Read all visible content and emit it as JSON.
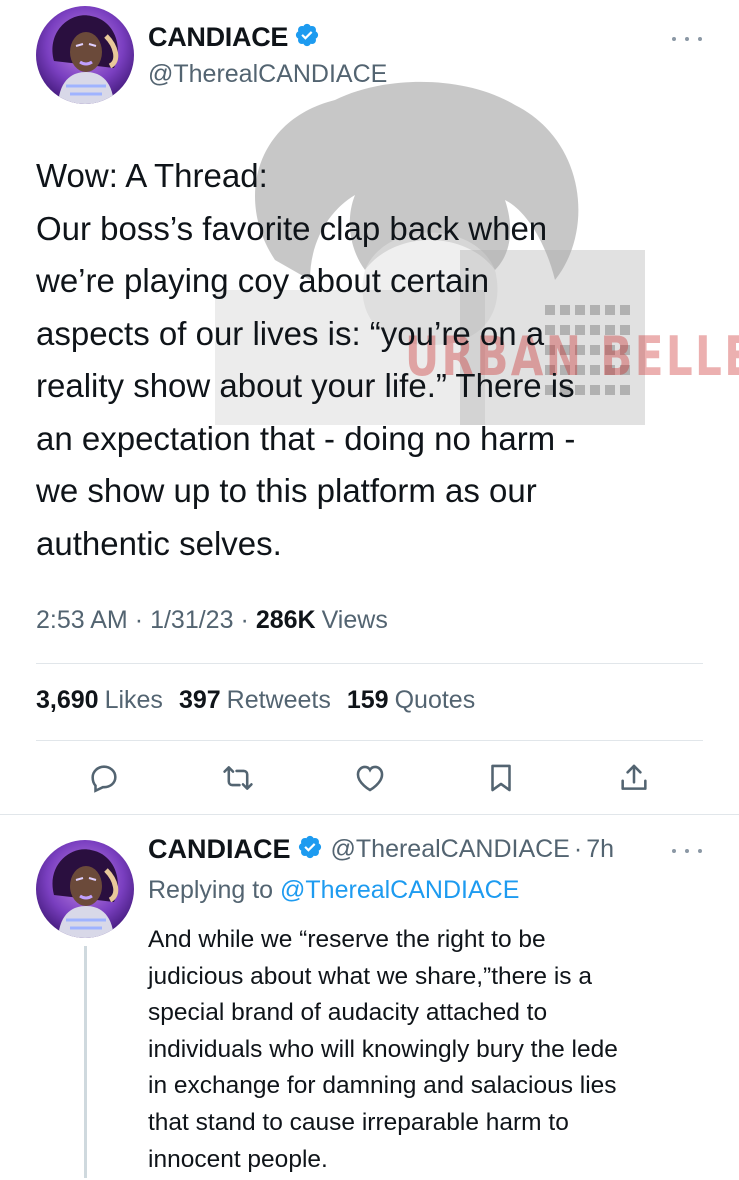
{
  "main_tweet": {
    "display_name": "CANDIACE",
    "handle": "@TherealCANDIACE",
    "text_lines": [
      "Wow: A Thread:",
      "Our boss’s favorite clap back when",
      "we’re playing coy about certain",
      "aspects of our lives is: “you’re on a",
      "reality show about your life.” There is",
      "an expectation that - doing no harm -",
      "we show up to this platform as our",
      "authentic selves."
    ],
    "time": "2:53 AM",
    "date": "1/31/23",
    "separator": "·",
    "views_count": "286K",
    "views_label": "Views",
    "likes_count": "3,690",
    "likes_label": "Likes",
    "retweets_count": "397",
    "retweets_label": "Retweets",
    "quotes_count": "159",
    "quotes_label": "Quotes"
  },
  "watermark": {
    "text": "URBAN BELLE"
  },
  "action_bar": {
    "icons": [
      "reply-icon",
      "retweet-icon",
      "like-icon",
      "bookmark-icon",
      "share-icon"
    ]
  },
  "reply_tweet": {
    "display_name": "CANDIACE",
    "handle": "@TherealCANDIACE",
    "separator": "·",
    "age": "7h",
    "replying_prefix": "Replying to",
    "replying_mention": "@TherealCANDIACE",
    "text_lines": [
      "And while we “reserve the right to be",
      "judicious about what we share,”there is a",
      "special brand of audacity attached to",
      "individuals who will knowingly bury the lede",
      "in exchange for damning and salacious lies",
      "that stand to cause irreparable harm to",
      "innocent people."
    ]
  },
  "colors": {
    "text_primary": "#0f1419",
    "text_secondary": "#536471",
    "accent_blue": "#1d9bf0",
    "divider": "#e1e6ea"
  }
}
